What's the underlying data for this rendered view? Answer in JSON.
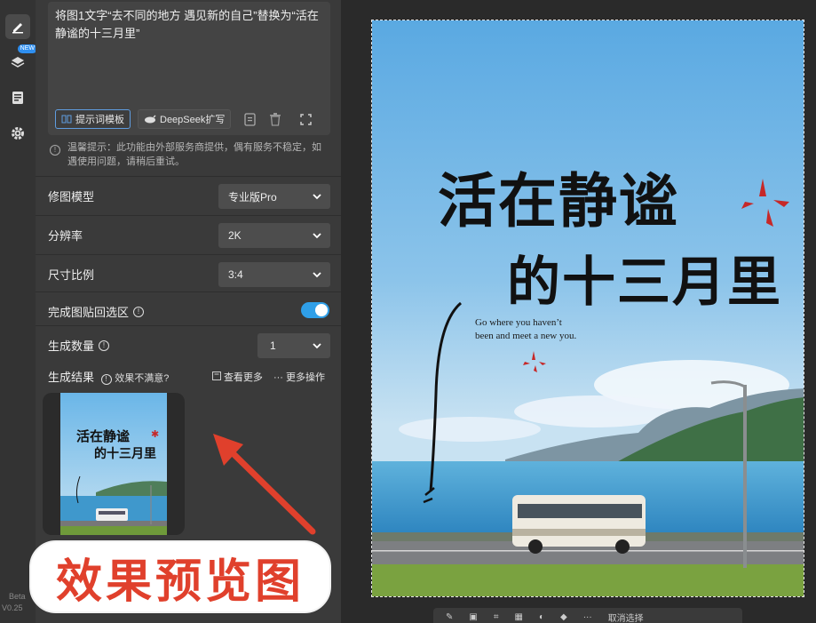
{
  "sidebar": {
    "new_badge": "NEW",
    "version_line1": "Beta",
    "version_line2": "V0.25"
  },
  "prompt": {
    "text": "将图1文字“去不同的地方 遇见新的自己”替换为“活在静谧的十三月里”",
    "template_button": "提示词模板",
    "deepseek_button": "DeepSeek扩写"
  },
  "notice": "温馨提示：此功能由外部服务商提供，偶有服务不稳定，如遇使用问题，请稍后重试。",
  "settings": {
    "model_label": "修图模型",
    "model_value": "专业版Pro",
    "resolution_label": "分辨率",
    "resolution_value": "2K",
    "ratio_label": "尺寸比例",
    "ratio_value": "3:4",
    "paste_back_label": "完成图贴回选区",
    "paste_back_on": true,
    "count_label": "生成数量",
    "count_value": "1"
  },
  "results": {
    "title": "生成结果",
    "hint": "效果不满意?",
    "view_more": "查看更多",
    "more_actions": "更多操作",
    "thumb_line1": "活在静谧",
    "thumb_line2": "的十三月里"
  },
  "annotation": {
    "callout_text": "效果预览图",
    "color": "#e0402c"
  },
  "artwork": {
    "title_line1": "活在静谧",
    "title_line2": "的十三月里",
    "en_line1": "Go where you haven’t",
    "en_line2": "been and meet a new you."
  },
  "canvas_toolbar": {
    "cancel_label": "取消选择"
  },
  "colors": {
    "accent": "#2f9fe8",
    "panel": "#3a3a3a",
    "sky_top": "#5fb0e6",
    "sea": "#3e9bd0"
  }
}
